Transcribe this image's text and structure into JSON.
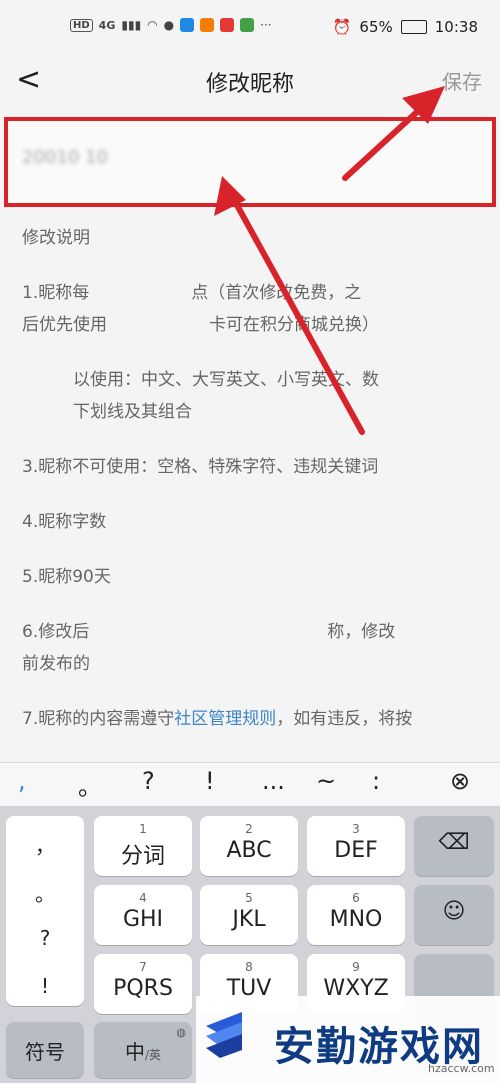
{
  "status": {
    "left_badges": [
      "HD",
      "4G"
    ],
    "battery": "65%",
    "time": "10:38"
  },
  "nav": {
    "back": "<",
    "title": "修改昵称",
    "save": "保存"
  },
  "input": {
    "value": "20010 10"
  },
  "notes": {
    "heading": "修改说明",
    "item1_line1": "1.昵称每　　　　　　点（首次修改免费，之",
    "item1_line2": "后优先使用　　　　　　卡可在积分商城兑换）",
    "item2_line1": "　　　以使用：中文、大写英文、小写英文、数",
    "item2_line2": "　　　下划线及其组合",
    "item3": "3.昵称不可使用：空格、特殊字符、违规关键词",
    "item4": "4.昵称字数",
    "item5": "5.昵称90天",
    "item6_line1": "6.修改后　　　　　　　　　　　　　　称，修改",
    "item6_line2": "前发布的",
    "item7_prefix": "7.昵称的内容需遵守",
    "item7_link": "社区管理规则",
    "item7_suffix": "，如有违反，将按"
  },
  "symbol_row": [
    ",",
    "。",
    "?",
    "!",
    "...",
    "~",
    ":",
    "⊗"
  ],
  "keyboard": {
    "punct": [
      "，",
      "。",
      "?",
      "!"
    ],
    "keys": [
      {
        "num": "1",
        "label": "分词"
      },
      {
        "num": "2",
        "label": "ABC"
      },
      {
        "num": "3",
        "label": "DEF"
      },
      {
        "num": "4",
        "label": "GHI"
      },
      {
        "num": "5",
        "label": "JKL"
      },
      {
        "num": "6",
        "label": "MNO"
      },
      {
        "num": "7",
        "label": "PQRS"
      },
      {
        "num": "8",
        "label": "TUV"
      },
      {
        "num": "9",
        "label": "WXYZ"
      }
    ],
    "symbols_key": "符号",
    "lang_key_main": "中",
    "lang_key_sub": "/英"
  },
  "watermark": {
    "title": "安勤游戏网",
    "url": "hzaccw.com"
  },
  "colors": {
    "annotation_red": "#d8232a",
    "link_blue": "#3c86c7",
    "keyboard_bg": "#d1d3d9"
  }
}
